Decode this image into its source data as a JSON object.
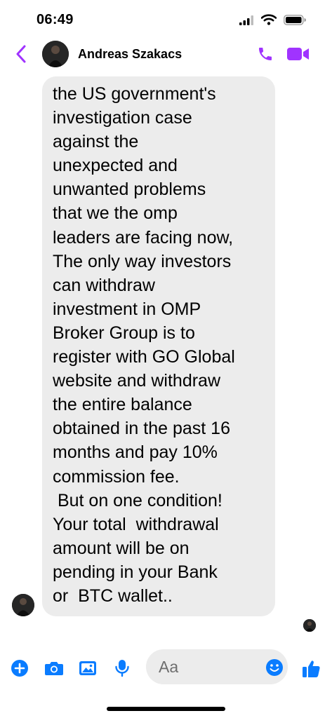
{
  "status_bar": {
    "time": "06:49"
  },
  "header": {
    "contact_name": "Andreas Szakacs"
  },
  "message": {
    "text": "the US government's\ninvestigation case\nagainst the\nunexpected and\nunwanted problems\nthat we the omp\nleaders are facing now,\nThe only way investors\ncan withdraw\ninvestment in OMP\nBroker Group is to\nregister with GO Global\nwebsite and withdraw\nthe entire balance\nobtained in the past 16\nmonths and pay 10%\ncommission fee.\n But on one condition!\nYour total  withdrawal\namount will be on\npending in your Bank\nor  BTC wallet.."
  },
  "composer": {
    "placeholder": "Aa"
  },
  "colors": {
    "accent": "#a033ff",
    "composer_blue": "#0a7cff",
    "bubble": "#ececec"
  },
  "icons": [
    "back-chevron-icon",
    "call-icon",
    "video-call-icon",
    "plus-icon",
    "camera-icon",
    "gallery-icon",
    "microphone-icon",
    "emoji-icon",
    "thumbs-up-icon"
  ]
}
